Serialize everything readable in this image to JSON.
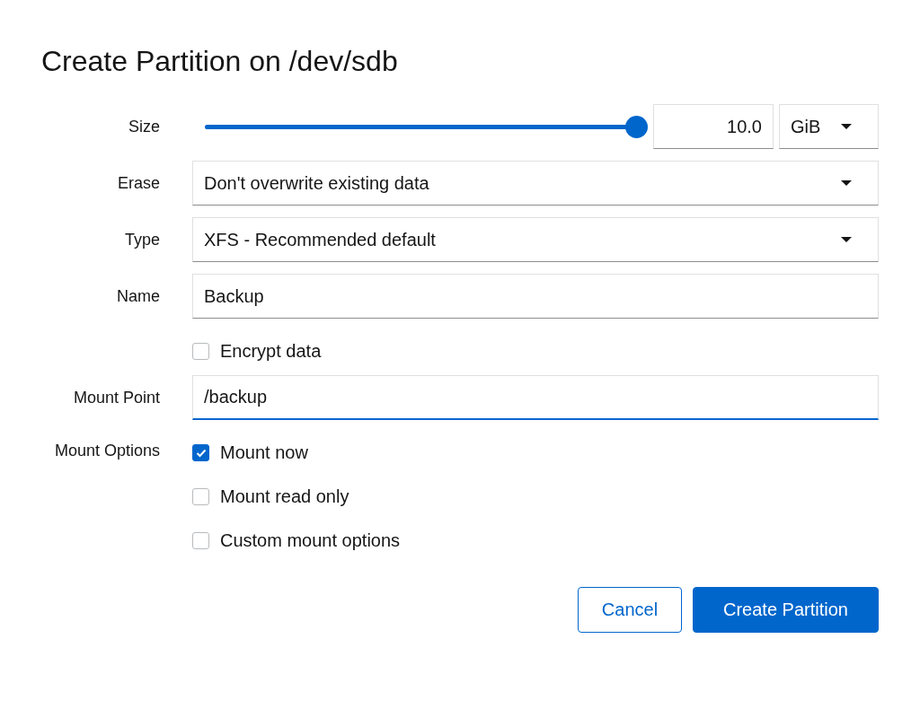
{
  "title": "Create Partition on /dev/sdb",
  "fields": [
    {
      "kind": "slider",
      "label": "Size",
      "level": 1,
      "value": "10.0",
      "unit": "GiB"
    },
    {
      "kind": "select",
      "label": "Erase",
      "value": "Don't overwrite existing data"
    },
    {
      "kind": "select",
      "label": "Type",
      "value": "XFS - Recommended default"
    },
    {
      "kind": "text",
      "label": "Name",
      "value": "Backup",
      "focused": false
    },
    {
      "kind": "checkboxes",
      "options": [
        {
          "label": "Encrypt data",
          "checked": false
        }
      ]
    },
    {
      "kind": "text",
      "label": "Mount Point",
      "value": "/backup",
      "focused": true
    },
    {
      "kind": "checkboxes",
      "label": "Mount Options",
      "options": [
        {
          "label": "Mount now",
          "checked": true
        },
        {
          "label": "Mount read only",
          "checked": false
        },
        {
          "label": "Custom mount options",
          "checked": false
        }
      ]
    }
  ],
  "buttons": [
    {
      "label": "Cancel",
      "primary": false
    },
    {
      "label": "Create Partition",
      "primary": true
    }
  ]
}
